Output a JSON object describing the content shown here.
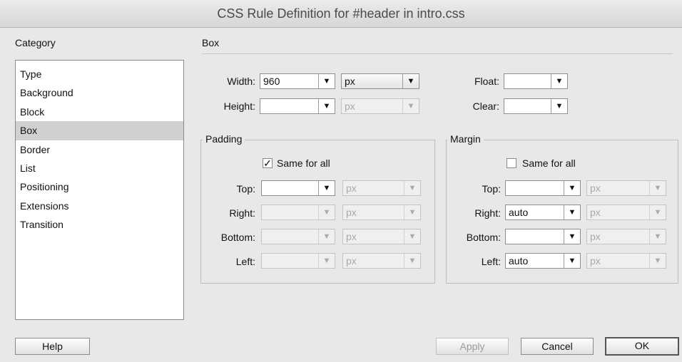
{
  "dialog": {
    "title": "CSS Rule Definition for #header in intro.css"
  },
  "category": {
    "heading": "Category",
    "items": [
      "Type",
      "Background",
      "Block",
      "Box",
      "Border",
      "List",
      "Positioning",
      "Extensions",
      "Transition"
    ],
    "selected": "Box"
  },
  "section": {
    "heading": "Box"
  },
  "box": {
    "width_label": "Width:",
    "width_value": "960",
    "width_unit": "px",
    "height_label": "Height:",
    "height_value": "",
    "height_unit": "px",
    "float_label": "Float:",
    "float_value": "",
    "clear_label": "Clear:",
    "clear_value": ""
  },
  "padding": {
    "legend": "Padding",
    "same_for_all_label": "Same for all",
    "same_for_all_checked": true,
    "check_mark": "✓",
    "top_label": "Top:",
    "top_value": "",
    "top_unit": "px",
    "right_label": "Right:",
    "right_value": "",
    "right_unit": "px",
    "bottom_label": "Bottom:",
    "bottom_value": "",
    "bottom_unit": "px",
    "left_label": "Left:",
    "left_value": "",
    "left_unit": "px"
  },
  "margin": {
    "legend": "Margin",
    "same_for_all_label": "Same for all",
    "same_for_all_checked": false,
    "top_label": "Top:",
    "top_value": "",
    "top_unit": "px",
    "right_label": "Right:",
    "right_value": "auto",
    "right_unit": "px",
    "bottom_label": "Bottom:",
    "bottom_value": "",
    "bottom_unit": "px",
    "left_label": "Left:",
    "left_value": "auto",
    "left_unit": "px"
  },
  "buttons": {
    "help": "Help",
    "apply": "Apply",
    "cancel": "Cancel",
    "ok": "OK"
  },
  "icons": {
    "dropdown_arrow": "▼"
  }
}
